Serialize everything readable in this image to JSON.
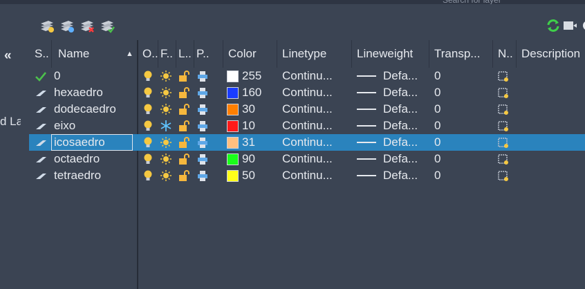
{
  "search": {
    "placeholder": "Search for layer"
  },
  "left": {
    "collapse_glyph": "«",
    "label": "d La"
  },
  "toolbar": {
    "icons": [
      "new-layer-icon",
      "new-layer-vp-frozen-icon",
      "delete-layer-icon",
      "set-current-layer-icon"
    ],
    "right_icons": [
      "refresh-icon",
      "layer-settings-icon",
      "gear-icon"
    ]
  },
  "columns": {
    "status": "S..",
    "name": "Name",
    "on": "O..",
    "freeze": "F..",
    "lock": "L..",
    "plot": "P..",
    "color": "Color",
    "linetype": "Linetype",
    "lineweight": "Lineweight",
    "transparency": "Transp...",
    "newvp": "N..",
    "description": "Description"
  },
  "layers": [
    {
      "name": "0",
      "status": "current",
      "frozen": false,
      "color_hex": "#ffffff",
      "color": "255",
      "linetype": "Continu...",
      "lineweight": "Defa...",
      "transparency": "0",
      "selected": false
    },
    {
      "name": "hexaedro",
      "status": "layer",
      "frozen": false,
      "color_hex": "#1a3cff",
      "color": "160",
      "linetype": "Continu...",
      "lineweight": "Defa...",
      "transparency": "0",
      "selected": false
    },
    {
      "name": "dodecaedro",
      "status": "layer",
      "frozen": false,
      "color_hex": "#ff7f00",
      "color": "30",
      "linetype": "Continu...",
      "lineweight": "Defa...",
      "transparency": "0",
      "selected": false
    },
    {
      "name": "eixo",
      "status": "layer",
      "frozen": true,
      "color_hex": "#ff1a1a",
      "color": "10",
      "linetype": "Continu...",
      "lineweight": "Defa...",
      "transparency": "0",
      "selected": false
    },
    {
      "name": "icosaedro",
      "status": "layer",
      "frozen": false,
      "color_hex": "#ffbf7f",
      "color": "31",
      "linetype": "Continu...",
      "lineweight": "Defa...",
      "transparency": "0",
      "selected": true
    },
    {
      "name": "octaedro",
      "status": "layer",
      "frozen": false,
      "color_hex": "#1aff1a",
      "color": "90",
      "linetype": "Continu...",
      "lineweight": "Defa...",
      "transparency": "0",
      "selected": false
    },
    {
      "name": "tetraedro",
      "status": "layer",
      "frozen": false,
      "color_hex": "#ffff1a",
      "color": "50",
      "linetype": "Continu...",
      "lineweight": "Defa...",
      "transparency": "0",
      "selected": false
    }
  ],
  "colors": {
    "selection": "#2a83bd",
    "bulb": "#f5c842",
    "check": "#4cc04c"
  }
}
